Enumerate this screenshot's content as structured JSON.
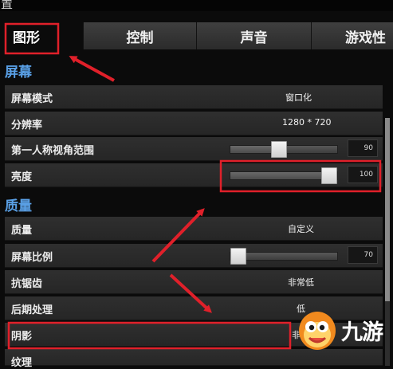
{
  "window": {
    "title": "置"
  },
  "tabs": [
    {
      "label": "图形",
      "active": true
    },
    {
      "label": "控制",
      "active": false
    },
    {
      "label": "声音",
      "active": false
    },
    {
      "label": "游戏性",
      "active": false
    }
  ],
  "sections": {
    "screen": "屏幕",
    "quality": "质量"
  },
  "rows": {
    "screen_mode": {
      "label": "屏幕模式",
      "value": "窗口化"
    },
    "resolution": {
      "label": "分辨率",
      "value": "1280 * 720"
    },
    "fov": {
      "label": "第一人称视角范围",
      "value": "90",
      "slider_fraction": 0.45
    },
    "brightness": {
      "label": "亮度",
      "value": "100",
      "slider_fraction": 1.0
    },
    "quality": {
      "label": "质量",
      "value": "自定义"
    },
    "screen_scale": {
      "label": "屏幕比例",
      "value": "70",
      "slider_fraction": 0.0
    },
    "anti_aliasing": {
      "label": "抗锯齿",
      "value": "非常低"
    },
    "post_processing": {
      "label": "后期处理",
      "value": "低"
    },
    "shadows": {
      "label": "阴影",
      "value": "非"
    },
    "textures": {
      "label": "纹理"
    }
  },
  "watermark": {
    "text": "九游"
  },
  "colors": {
    "section_heading": "#5aa0e6",
    "annotation_red": "#e0202a",
    "row_bg": "#2b2b2b"
  }
}
